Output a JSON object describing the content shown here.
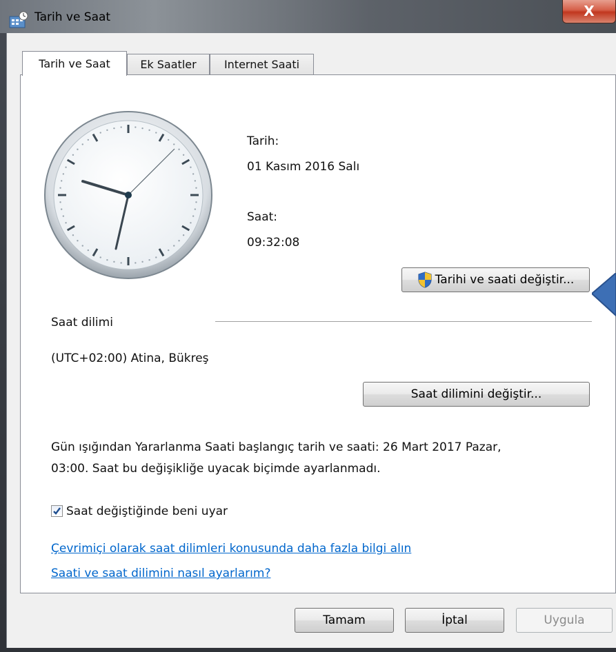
{
  "window": {
    "title": "Tarih ve Saat",
    "close_glyph": "X"
  },
  "tabs": [
    {
      "label": "Tarih ve Saat",
      "active": true
    },
    {
      "label": "Ek Saatler",
      "active": false
    },
    {
      "label": "Internet Saati",
      "active": false
    }
  ],
  "date_time": {
    "date_label": "Tarih:",
    "date_value": "01 Kasım 2016 Salı",
    "time_label": "Saat:",
    "time_value": "09:32:08",
    "change_button": "Tarihi ve saati değiştir..."
  },
  "timezone": {
    "section_label": "Saat dilimi",
    "value": "(UTC+02:00) Atina, Bükreş",
    "change_button": "Saat dilimini değiştir..."
  },
  "dst": {
    "line1": "Gün ışığından Yararlanma Saati başlangıç tarih ve saati: 26 Mart 2017 Pazar,",
    "line2": "03:00. Saat bu değişikliğe uyacak biçimde ayarlanmadı."
  },
  "notify": {
    "label": "Saat değiştiğinde beni uyar",
    "checked": true
  },
  "links": {
    "online_info": "Çevrimiçi olarak saat dilimleri konusunda daha fazla bilgi alın",
    "how_to": "Saati ve saat dilimini nasıl ayarlarım?"
  },
  "footer": {
    "ok": "Tamam",
    "cancel": "İptal",
    "apply": "Uygula"
  },
  "colors": {
    "link": "#0066cc",
    "annotation_arrow": "#3d6fb5"
  },
  "icons": [
    "window-clock-icon",
    "close-icon",
    "uac-shield-icon",
    "checkmark-icon",
    "annotation-arrow-icon"
  ]
}
